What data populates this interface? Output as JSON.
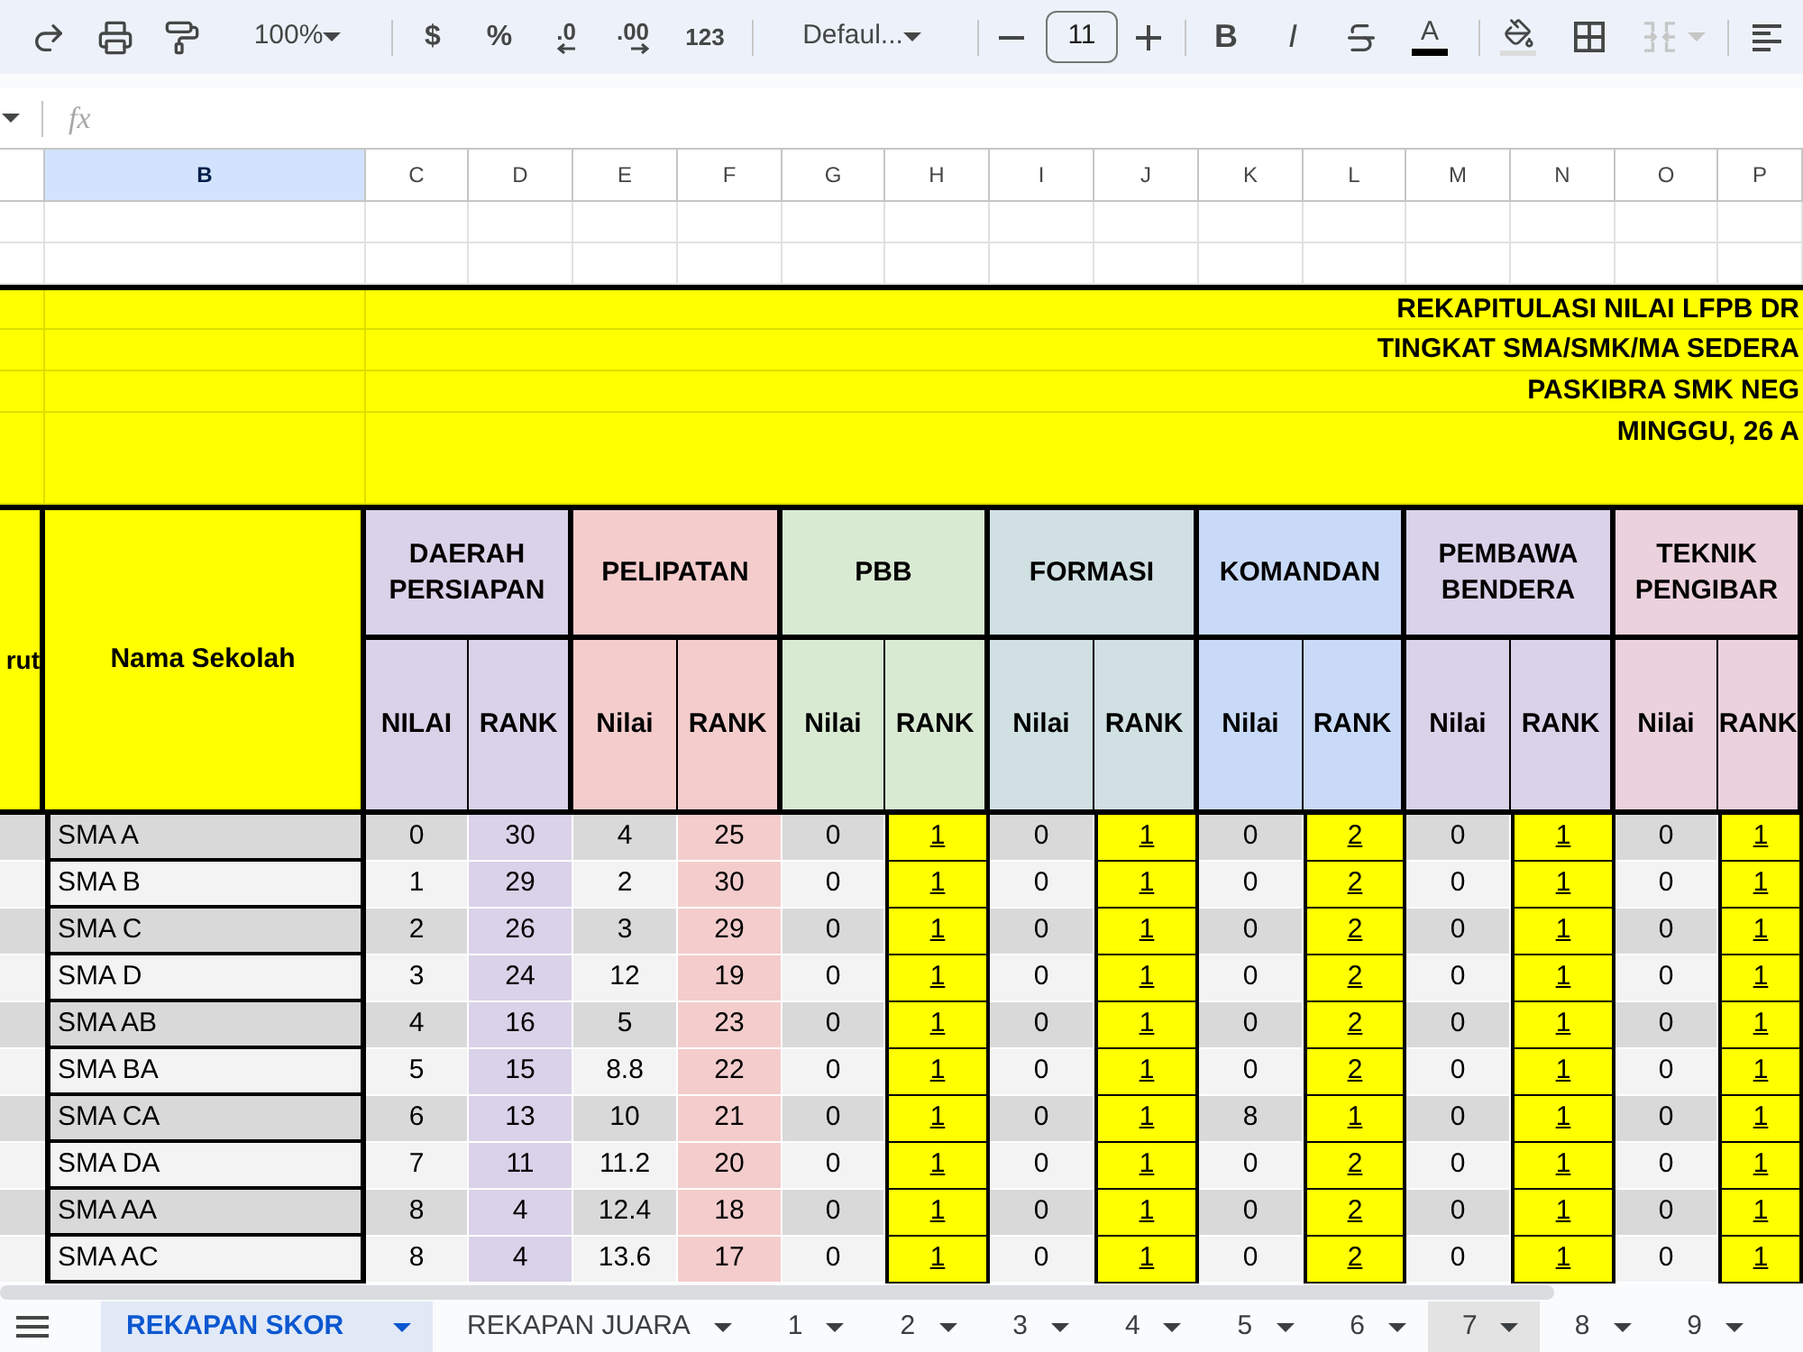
{
  "toolbar": {
    "zoom": "100%",
    "currency": "$",
    "percent": "%",
    "decrease_decimal": ".0",
    "increase_decimal": ".00",
    "number_format": "123",
    "font": "Defaul...",
    "font_size": "11",
    "bold": "B",
    "italic": "I",
    "text_color": "A",
    "merge_disabled": true
  },
  "formula_bar": {
    "fx": "fx"
  },
  "columns": [
    {
      "letter": "B",
      "selected": true
    },
    {
      "letter": "C",
      "selected": false
    },
    {
      "letter": "D",
      "selected": false
    },
    {
      "letter": "E",
      "selected": false
    },
    {
      "letter": "F",
      "selected": false
    },
    {
      "letter": "G",
      "selected": false
    },
    {
      "letter": "H",
      "selected": false
    },
    {
      "letter": "I",
      "selected": false
    },
    {
      "letter": "J",
      "selected": false
    },
    {
      "letter": "K",
      "selected": false
    },
    {
      "letter": "L",
      "selected": false
    },
    {
      "letter": "M",
      "selected": false
    },
    {
      "letter": "N",
      "selected": false
    },
    {
      "letter": "O",
      "selected": false
    },
    {
      "letter": "P",
      "selected": false
    }
  ],
  "banner": {
    "lines": [
      "REKAPITULASI NILAI LFPB DR",
      "TINGKAT SMA/SMK/MA SEDERA",
      "PASKIBRA SMK NEG",
      "MINGGU, 26 A"
    ]
  },
  "table": {
    "number_header": "rut",
    "name_header": "Nama Sekolah",
    "groups": [
      {
        "title": "DAERAH PERSIAPAN",
        "color": "#d9d2e9",
        "rank_highlighted": false,
        "subheaders": [
          "NILAI",
          "RANK"
        ]
      },
      {
        "title": "PELIPATAN",
        "color": "#f4cccc",
        "rank_highlighted": false,
        "subheaders": [
          "Nilai",
          "RANK"
        ]
      },
      {
        "title": "PBB",
        "color": "#d9ead3",
        "rank_highlighted": true,
        "subheaders": [
          "Nilai",
          "RANK"
        ]
      },
      {
        "title": "FORMASI",
        "color": "#d0e0e3",
        "rank_highlighted": true,
        "subheaders": [
          "Nilai",
          "RANK"
        ]
      },
      {
        "title": "KOMANDAN",
        "color": "#c9daf8",
        "rank_highlighted": true,
        "subheaders": [
          "Nilai",
          "RANK"
        ]
      },
      {
        "title": "PEMBAWA BENDERA",
        "color": "#d9d2e9",
        "rank_highlighted": true,
        "subheaders": [
          "Nilai",
          "RANK"
        ]
      },
      {
        "title": "TEKNIK PENGIBAR",
        "color": "#ead1dc",
        "rank_highlighted": true,
        "subheaders": [
          "Nilai",
          "RANK"
        ]
      }
    ],
    "rows": [
      {
        "name": "SMA A",
        "cells": [
          "0",
          "30",
          "4",
          "25",
          "0",
          "1",
          "0",
          "1",
          "0",
          "2",
          "0",
          "1",
          "0",
          "1"
        ]
      },
      {
        "name": "SMA B",
        "cells": [
          "1",
          "29",
          "2",
          "30",
          "0",
          "1",
          "0",
          "1",
          "0",
          "2",
          "0",
          "1",
          "0",
          "1"
        ]
      },
      {
        "name": "SMA C",
        "cells": [
          "2",
          "26",
          "3",
          "29",
          "0",
          "1",
          "0",
          "1",
          "0",
          "2",
          "0",
          "1",
          "0",
          "1"
        ]
      },
      {
        "name": "SMA D",
        "cells": [
          "3",
          "24",
          "12",
          "19",
          "0",
          "1",
          "0",
          "1",
          "0",
          "2",
          "0",
          "1",
          "0",
          "1"
        ]
      },
      {
        "name": "SMA AB",
        "cells": [
          "4",
          "16",
          "5",
          "23",
          "0",
          "1",
          "0",
          "1",
          "0",
          "2",
          "0",
          "1",
          "0",
          "1"
        ]
      },
      {
        "name": "SMA BA",
        "cells": [
          "5",
          "15",
          "8.8",
          "22",
          "0",
          "1",
          "0",
          "1",
          "0",
          "2",
          "0",
          "1",
          "0",
          "1"
        ]
      },
      {
        "name": "SMA CA",
        "cells": [
          "6",
          "13",
          "10",
          "21",
          "0",
          "1",
          "0",
          "1",
          "8",
          "1",
          "0",
          "1",
          "0",
          "1"
        ]
      },
      {
        "name": "SMA DA",
        "cells": [
          "7",
          "11",
          "11.2",
          "20",
          "0",
          "1",
          "0",
          "1",
          "0",
          "2",
          "0",
          "1",
          "0",
          "1"
        ]
      },
      {
        "name": "SMA AA",
        "cells": [
          "8",
          "4",
          "12.4",
          "18",
          "0",
          "1",
          "0",
          "1",
          "0",
          "2",
          "0",
          "1",
          "0",
          "1"
        ]
      },
      {
        "name": "SMA AC",
        "cells": [
          "8",
          "4",
          "13.6",
          "17",
          "0",
          "1",
          "0",
          "1",
          "0",
          "2",
          "0",
          "1",
          "0",
          "1"
        ]
      }
    ]
  },
  "sheet_tabs": [
    {
      "label": "REKAPAN SKOR",
      "selected": true,
      "hovered": false
    },
    {
      "label": "REKAPAN JUARA",
      "selected": false,
      "hovered": false
    },
    {
      "label": "1",
      "selected": false,
      "hovered": false
    },
    {
      "label": "2",
      "selected": false,
      "hovered": false
    },
    {
      "label": "3",
      "selected": false,
      "hovered": false
    },
    {
      "label": "4",
      "selected": false,
      "hovered": false
    },
    {
      "label": "5",
      "selected": false,
      "hovered": false
    },
    {
      "label": "6",
      "selected": false,
      "hovered": false
    },
    {
      "label": "7",
      "selected": false,
      "hovered": true
    },
    {
      "label": "8",
      "selected": false,
      "hovered": false
    },
    {
      "label": "9",
      "selected": false,
      "hovered": false
    }
  ]
}
